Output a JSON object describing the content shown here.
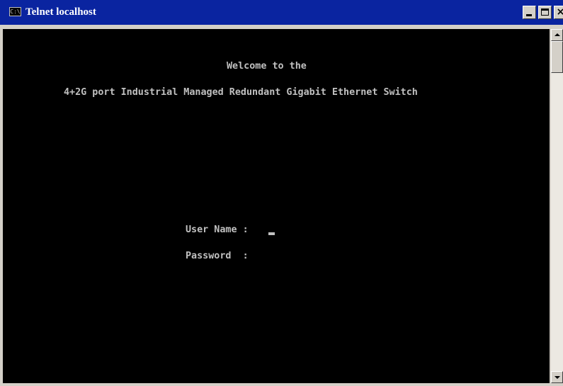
{
  "window": {
    "title": "Telnet localhost",
    "icon": "console-icon",
    "icon_text": "C:\\",
    "controls": {
      "minimize": "minimize-icon",
      "maximize": "maximize-icon",
      "close_label": "×"
    }
  },
  "console": {
    "lines": {
      "welcome": "Welcome to the",
      "product": "4+2G port Industrial Managed Redundant Gigabit Ethernet Switch",
      "username_prompt": "User Name : ",
      "password_prompt": "Password  : "
    },
    "username_value": "",
    "password_value": ""
  },
  "colors": {
    "titlebar": "#0a24a0",
    "console_bg": "#000000",
    "console_text": "#c0c0c0",
    "chrome": "#d4d0c8"
  }
}
